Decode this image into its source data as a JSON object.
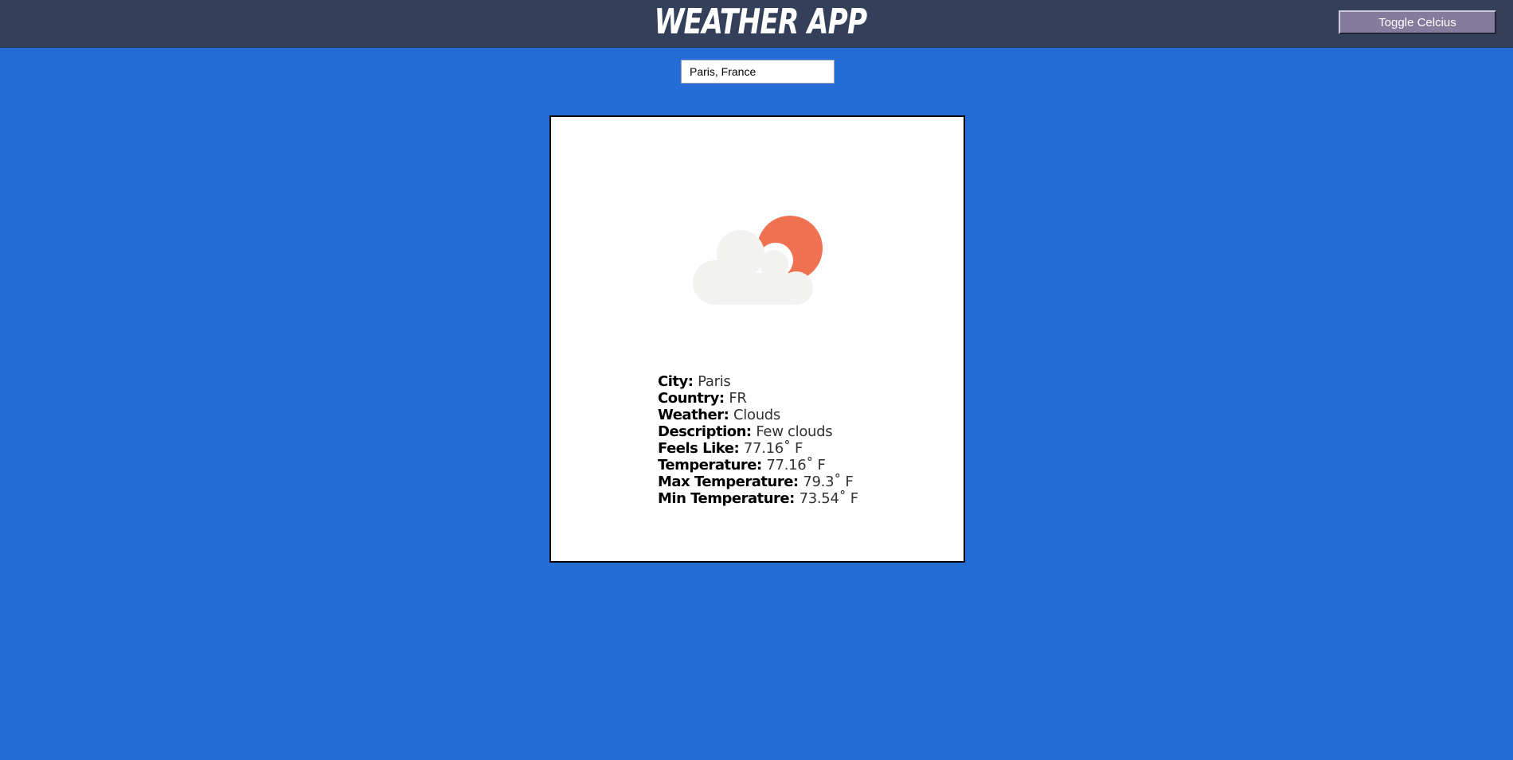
{
  "header": {
    "title": "WEATHER APP",
    "toggle_label": "Toggle Celcius"
  },
  "search": {
    "value": "Paris, France"
  },
  "weather": {
    "icon": "few-clouds-icon",
    "rows": [
      {
        "label": "City:",
        "value": "Paris"
      },
      {
        "label": "Country:",
        "value": "FR"
      },
      {
        "label": "Weather:",
        "value": "Clouds"
      },
      {
        "label": "Description:",
        "value": "Few clouds"
      },
      {
        "label": "Feels Like:",
        "value": "77.16˚ F"
      },
      {
        "label": "Temperature:",
        "value": "77.16˚ F"
      },
      {
        "label": "Max Temperature:",
        "value": "79.3˚ F"
      },
      {
        "label": "Min Temperature:",
        "value": "73.54˚ F"
      }
    ]
  },
  "colors": {
    "background": "#246dd4",
    "header": "#34405a",
    "toggle_button": "#847b9d",
    "sun": "#ef7150",
    "cloud": "#f2f2f0"
  }
}
